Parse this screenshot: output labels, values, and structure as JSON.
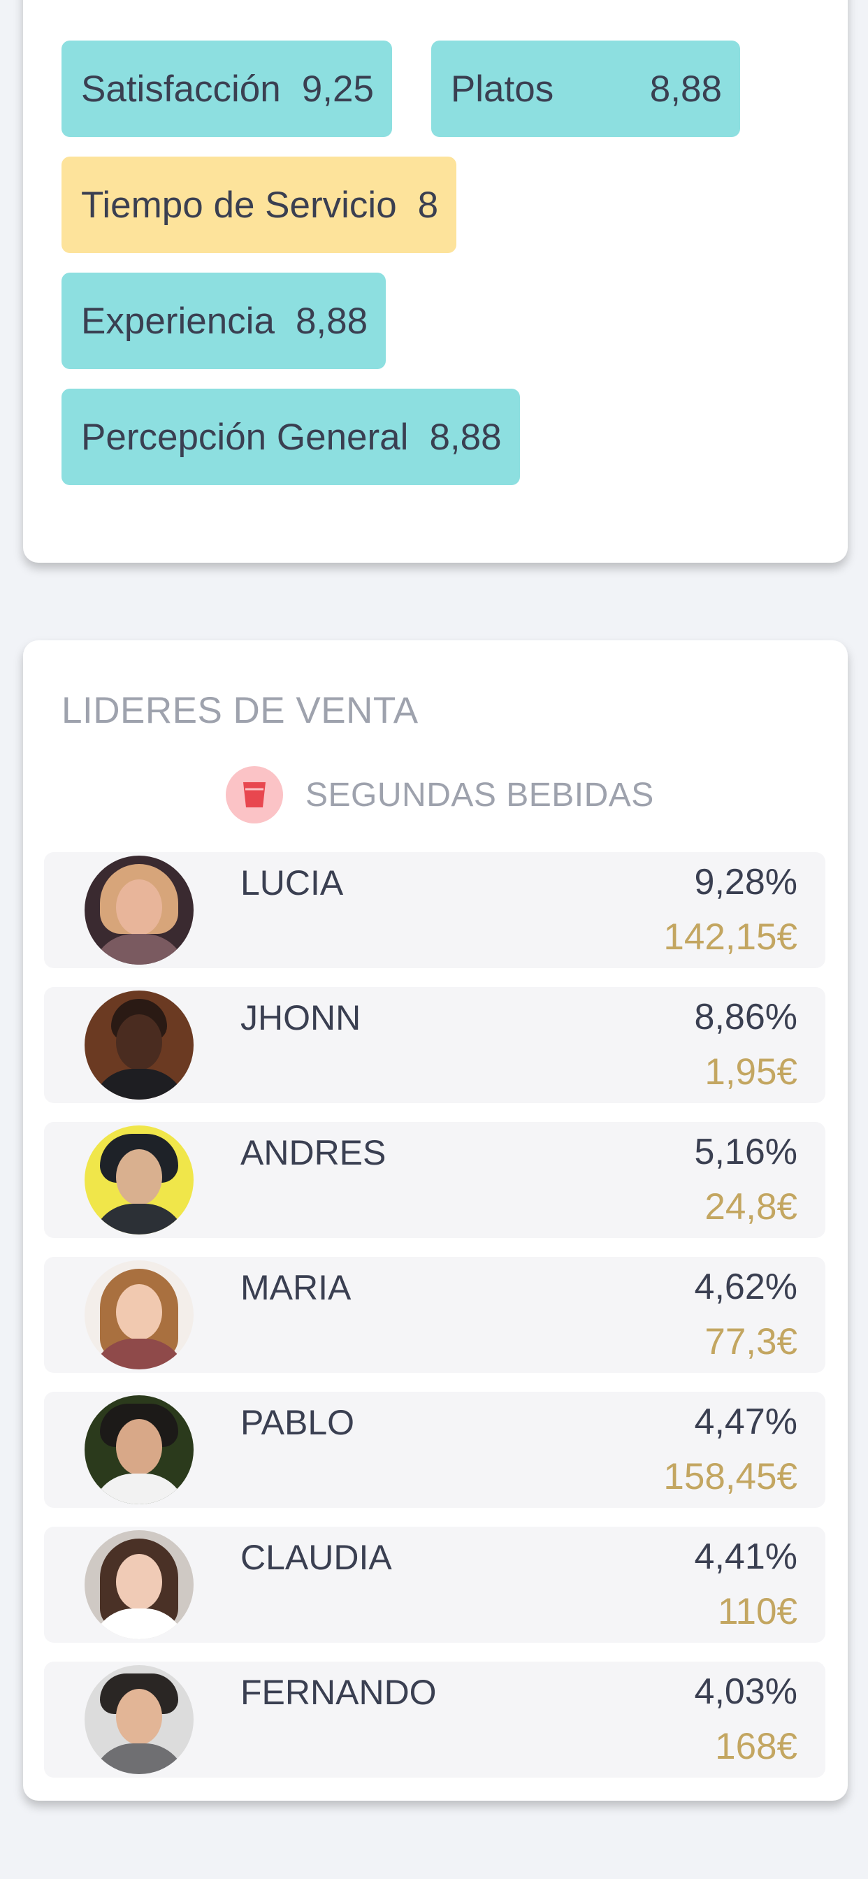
{
  "ratings": {
    "row1": [
      {
        "label": "Satisfacción",
        "value": "9,25",
        "color": "#8ddfe0"
      },
      {
        "label": "Platos",
        "value": "8,88",
        "color": "#8ddfe0"
      }
    ],
    "row2": [
      {
        "label": "Tiempo de Servicio",
        "value": "8",
        "color": "#fde39b"
      }
    ],
    "row3": [
      {
        "label": "Experiencia",
        "value": "8,88",
        "color": "#8ddfe0"
      }
    ],
    "row4": [
      {
        "label": "Percepción General",
        "value": "8,88",
        "color": "#8ddfe0"
      }
    ]
  },
  "sales_leaders": {
    "title": "LIDERES DE VENTA",
    "category": {
      "label": "SEGUNDAS BEBIDAS",
      "icon": "cup-icon",
      "icon_bg": "#fbc3c6",
      "icon_color": "#e8474f"
    },
    "amount_color": "#c3a661",
    "leaders": [
      {
        "name": "LUCIA",
        "percent": "9,28%",
        "amount": "142,15€",
        "avatar": "avatar-photo"
      },
      {
        "name": "JHONN",
        "percent": "8,86%",
        "amount": "1,95€",
        "avatar": "avatar-photo"
      },
      {
        "name": "ANDRES",
        "percent": "5,16%",
        "amount": "24,8€",
        "avatar": "avatar-photo"
      },
      {
        "name": "MARIA",
        "percent": "4,62%",
        "amount": "77,3€",
        "avatar": "avatar-photo"
      },
      {
        "name": "PABLO",
        "percent": "4,47%",
        "amount": "158,45€",
        "avatar": "avatar-photo"
      },
      {
        "name": "CLAUDIA",
        "percent": "4,41%",
        "amount": "110€",
        "avatar": "avatar-photo"
      },
      {
        "name": "FERNANDO",
        "percent": "4,03%",
        "amount": "168€",
        "avatar": "avatar-photo"
      }
    ]
  }
}
